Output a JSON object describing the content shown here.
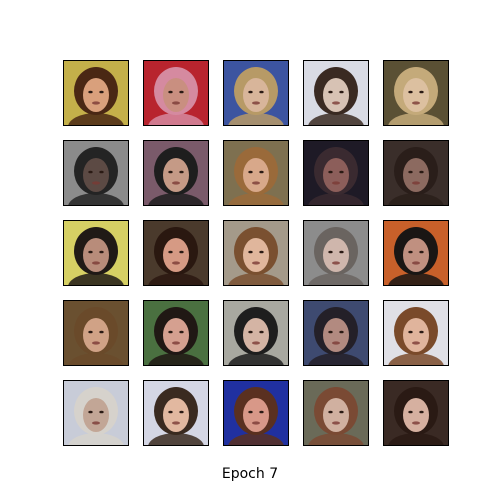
{
  "caption": "Epoch 7",
  "grid": {
    "rows": 5,
    "cols": 5,
    "tiles": [
      {
        "bg": "#c4b04a",
        "hair": "#4a2814",
        "skin": "#d9a07c"
      },
      {
        "bg": "#b8242e",
        "hair": "#d58aa0",
        "skin": "#c98f80"
      },
      {
        "bg": "#3c54a0",
        "hair": "#b79a66",
        "skin": "#d8b59a"
      },
      {
        "bg": "#d9dbe4",
        "hair": "#3a2a22",
        "skin": "#d7c2b4"
      },
      {
        "bg": "#5a5034",
        "hair": "#c4aa7a",
        "skin": "#dcc0a0"
      },
      {
        "bg": "#8b8b8b",
        "hair": "#242424",
        "skin": "#5c4a44"
      },
      {
        "bg": "#7a5a6a",
        "hair": "#1e1e1e",
        "skin": "#c59a86"
      },
      {
        "bg": "#7e7050",
        "hair": "#9a6a3a",
        "skin": "#d8a88a"
      },
      {
        "bg": "#1e1a26",
        "hair": "#3a2a30",
        "skin": "#8c5e5a"
      },
      {
        "bg": "#3a2e2a",
        "hair": "#2a1e1a",
        "skin": "#8c6a60"
      },
      {
        "bg": "#d6d064",
        "hair": "#201a16",
        "skin": "#b88c7a"
      },
      {
        "bg": "#4a3a2c",
        "hair": "#2a1810",
        "skin": "#d69a84"
      },
      {
        "bg": "#a49a8a",
        "hair": "#7a5030",
        "skin": "#e0b69c"
      },
      {
        "bg": "#8c8c8c",
        "hair": "#6a6460",
        "skin": "#cfb6ac"
      },
      {
        "bg": "#c8602a",
        "hair": "#1a1614",
        "skin": "#c09080"
      },
      {
        "bg": "#6a5030",
        "hair": "#6a4a2a",
        "skin": "#d0a286"
      },
      {
        "bg": "#4a7040",
        "hair": "#201814",
        "skin": "#d5a090"
      },
      {
        "bg": "#a8a8a0",
        "hair": "#1e1e1e",
        "skin": "#d4b4a4"
      },
      {
        "bg": "#3e4a70",
        "hair": "#242028",
        "skin": "#b28a80"
      },
      {
        "bg": "#e0e0e6",
        "hair": "#7a4a2a",
        "skin": "#e0b49c"
      },
      {
        "bg": "#c8ccd8",
        "hair": "#d6d2cc",
        "skin": "#c2a696"
      },
      {
        "bg": "#d4d6e4",
        "hair": "#3a2a20",
        "skin": "#e2b8a0"
      },
      {
        "bg": "#2030a0",
        "hair": "#5a3020",
        "skin": "#d89888"
      },
      {
        "bg": "#6a6a58",
        "hair": "#7a4a34",
        "skin": "#d0b0a0"
      },
      {
        "bg": "#3a2a24",
        "hair": "#2a1a14",
        "skin": "#d6b0a0"
      }
    ]
  }
}
